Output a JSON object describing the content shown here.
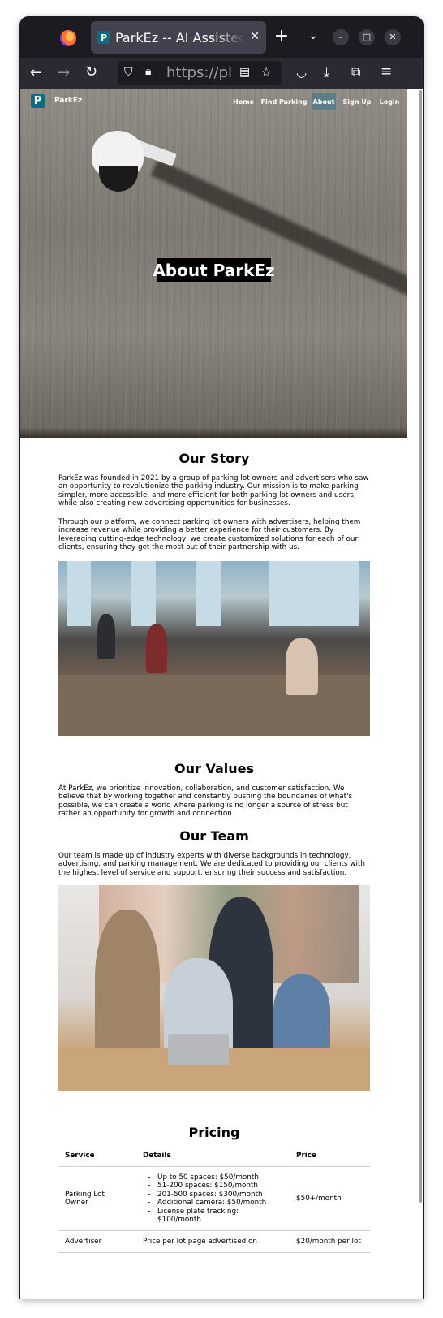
{
  "browser": {
    "tab_title": "ParkEz -- AI Assistec",
    "tab_favicon": "P",
    "url": "https://pl",
    "icons": [
      "firefox-logo",
      "close-icon",
      "plus-icon",
      "chevron-down-icon",
      "minimize-icon",
      "maximize-icon",
      "close-window-icon",
      "back-icon",
      "forward-icon",
      "reload-icon",
      "shield-icon",
      "lock-icon",
      "reader-icon",
      "star-icon",
      "pocket-icon",
      "download-icon",
      "extensions-icon",
      "menu-icon"
    ]
  },
  "site": {
    "logo_letter": "P",
    "brand": "ParkEz",
    "nav": [
      "Home",
      "Find Parking",
      "About",
      "Sign Up",
      "Login"
    ],
    "active_nav": "About",
    "accent": "#0e6b80"
  },
  "hero": {
    "title": "About ParkEz"
  },
  "story": {
    "title": "Our Story",
    "p1": "ParkEz was founded in 2021 by a group of parking lot owners and advertisers who saw an opportunity to revolutionize the parking industry. Our mission is to make parking simpler, more accessible, and more efficient for both parking lot owners and users, while also creating new advertising opportunities for businesses.",
    "p2": "Through our platform, we connect parking lot owners with advertisers, helping them increase revenue while providing a better experience for their customers. By leveraging cutting-edge technology, we create customized solutions for each of our clients, ensuring they get the most out of their partnership with us."
  },
  "values": {
    "title": "Our Values",
    "p": "At ParkEz, we prioritize innovation, collaboration, and customer satisfaction. We believe that by working together and constantly pushing the boundaries of what's possible, we can create a world where parking is no longer a source of stress but rather an opportunity for growth and connection."
  },
  "team": {
    "title": "Our Team",
    "p": "Our team is made up of industry experts with diverse backgrounds in technology, advertising, and parking management. We are dedicated to providing our clients with the highest level of service and support, ensuring their success and satisfaction."
  },
  "pricing": {
    "title": "Pricing",
    "headers": [
      "Service",
      "Details",
      "Price"
    ],
    "rows": [
      {
        "service": "Parking Lot Owner",
        "details": [
          "Up to 50 spaces: $50/month",
          "51-200 spaces: $150/month",
          "201-500 spaces: $300/month",
          "Additional camera: $50/month",
          "License plate tracking: $100/month"
        ],
        "price": "$50+/month"
      },
      {
        "service": "Advertiser",
        "details_text": "Price per lot page advertised on",
        "price": "$20/month per lot"
      }
    ]
  }
}
